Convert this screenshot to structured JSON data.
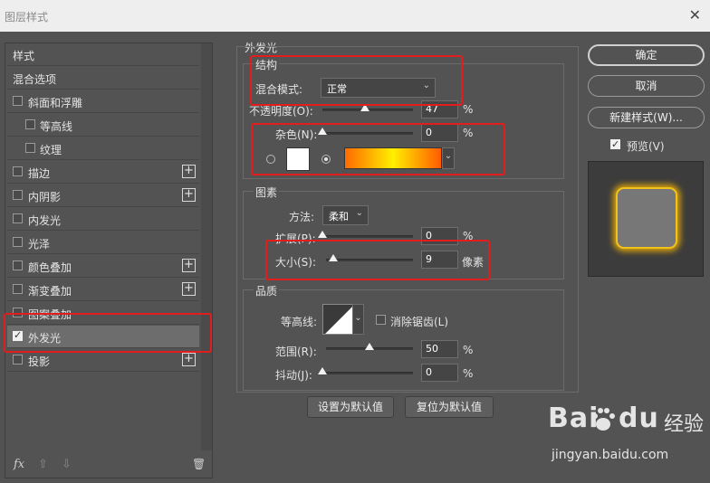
{
  "window": {
    "title": "图层样式",
    "close_symbol": "✕"
  },
  "left_panel": {
    "items": [
      {
        "label": "样式",
        "type": "header"
      },
      {
        "label": "混合选项",
        "type": "header"
      },
      {
        "label": "斜面和浮雕",
        "type": "option",
        "checked": false,
        "plus": false
      },
      {
        "label": "等高线",
        "type": "sub",
        "checked": false,
        "plus": false
      },
      {
        "label": "纹理",
        "type": "sub",
        "checked": false,
        "plus": false
      },
      {
        "label": "描边",
        "type": "option",
        "checked": false,
        "plus": true
      },
      {
        "label": "内阴影",
        "type": "option",
        "checked": false,
        "plus": true
      },
      {
        "label": "内发光",
        "type": "option",
        "checked": false,
        "plus": false
      },
      {
        "label": "光泽",
        "type": "option",
        "checked": false,
        "plus": false
      },
      {
        "label": "颜色叠加",
        "type": "option",
        "checked": false,
        "plus": true
      },
      {
        "label": "渐变叠加",
        "type": "option",
        "checked": false,
        "plus": true
      },
      {
        "label": "图案叠加",
        "type": "option",
        "checked": false,
        "plus": false
      },
      {
        "label": "外发光",
        "type": "option",
        "checked": true,
        "plus": false
      },
      {
        "label": "投影",
        "type": "option",
        "checked": false,
        "plus": true
      }
    ],
    "fx_label": "fx",
    "up_symbol": "⇧",
    "down_symbol": "⇩",
    "trash_symbol": "🗑"
  },
  "outer_glow": {
    "title": "外发光",
    "structure": {
      "title": "结构",
      "blend_mode_label": "混合模式:",
      "blend_mode_value": "正常",
      "opacity_label": "不透明度(O):",
      "opacity_value": "47",
      "opacity_level": 0.47,
      "noise_label": "杂色(N):",
      "noise_value": "0",
      "noise_level": 0,
      "percent": "%"
    },
    "elements": {
      "title": "图素",
      "method_label": "方法:",
      "method_value": "柔和",
      "spread_label": "扩展(P):",
      "spread_value": "0",
      "spread_level": 0,
      "size_label": "大小(S):",
      "size_value": "9",
      "size_unit": "像素",
      "percent": "%"
    },
    "quality": {
      "title": "品质",
      "contour_label": "等高线:",
      "antialias_label": "消除锯齿(L)",
      "range_label": "范围(R):",
      "range_value": "50",
      "range_level": 0.5,
      "jitter_label": "抖动(J):",
      "jitter_value": "0",
      "jitter_level": 0,
      "percent": "%"
    },
    "set_default_button": "设置为默认值",
    "reset_default_button": "复位为默认值"
  },
  "right_panel": {
    "ok_button": "确定",
    "cancel_button": "取消",
    "new_style_button": "新建样式(W)...",
    "preview_label": "预览(V)",
    "preview_checked": true
  },
  "colors": {
    "annotation": "#e21d1d",
    "glow_color": "#f2c21a",
    "gradient_start": "#ff6a00",
    "gradient_mid": "#ffef00",
    "gradient_end": "#ff5a00"
  },
  "watermark": {
    "brand": "Bai",
    "brand_suffix": "du",
    "sub": "经验",
    "url": "jingyan.baidu.com"
  }
}
